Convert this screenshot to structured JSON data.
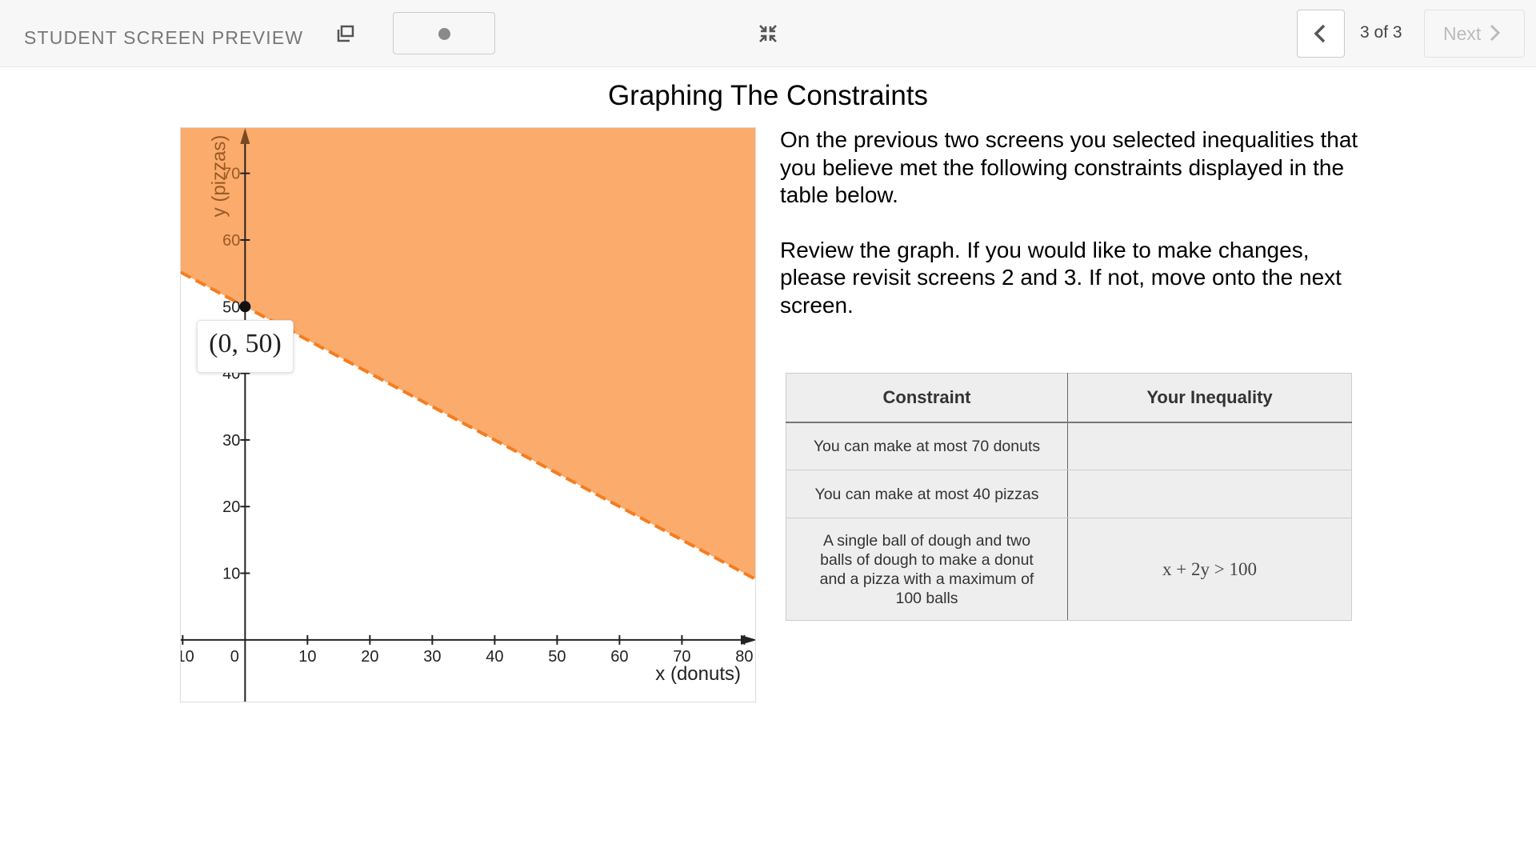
{
  "topbar": {
    "preview_label": "STUDENT SCREEN PREVIEW",
    "page_count": "3 of 3",
    "next_label": "Next"
  },
  "title": "Graphing The Constraints",
  "description": [
    "On the previous two screens you selected inequalities that you believe met the following constraints displayed in the table below.",
    "Review the graph.  If you would like to make changes, please revisit screens 2 and 3.  If not, move onto the next screen."
  ],
  "table": {
    "headers": [
      "Constraint",
      "Your Inequality"
    ],
    "rows": [
      {
        "constraint": "You can make at most 70 donuts",
        "inequality": ""
      },
      {
        "constraint": "You can make at most 40 pizzas",
        "inequality": ""
      },
      {
        "constraint": "A single ball of dough and two balls of dough to make a donut and a pizza with a maximum of 100 balls",
        "inequality": "x + 2y > 100"
      }
    ]
  },
  "graph": {
    "xlabel": "x (donuts)",
    "ylabel": "y (pizzas)",
    "xlim": [
      -10.3,
      82
    ],
    "ylim": [
      -9.5,
      76.8
    ],
    "xticks": [
      -10,
      0,
      10,
      20,
      30,
      40,
      50,
      60,
      70,
      80
    ],
    "yticks": [
      10,
      20,
      30,
      40,
      50,
      60,
      70
    ],
    "inequality": "x + 2y > 100",
    "boundary": "dashed",
    "shade_color": "#fbab6b",
    "line_color": "#f57d1f",
    "point": {
      "x": 0,
      "y": 50,
      "label": "(0, 50)"
    }
  }
}
